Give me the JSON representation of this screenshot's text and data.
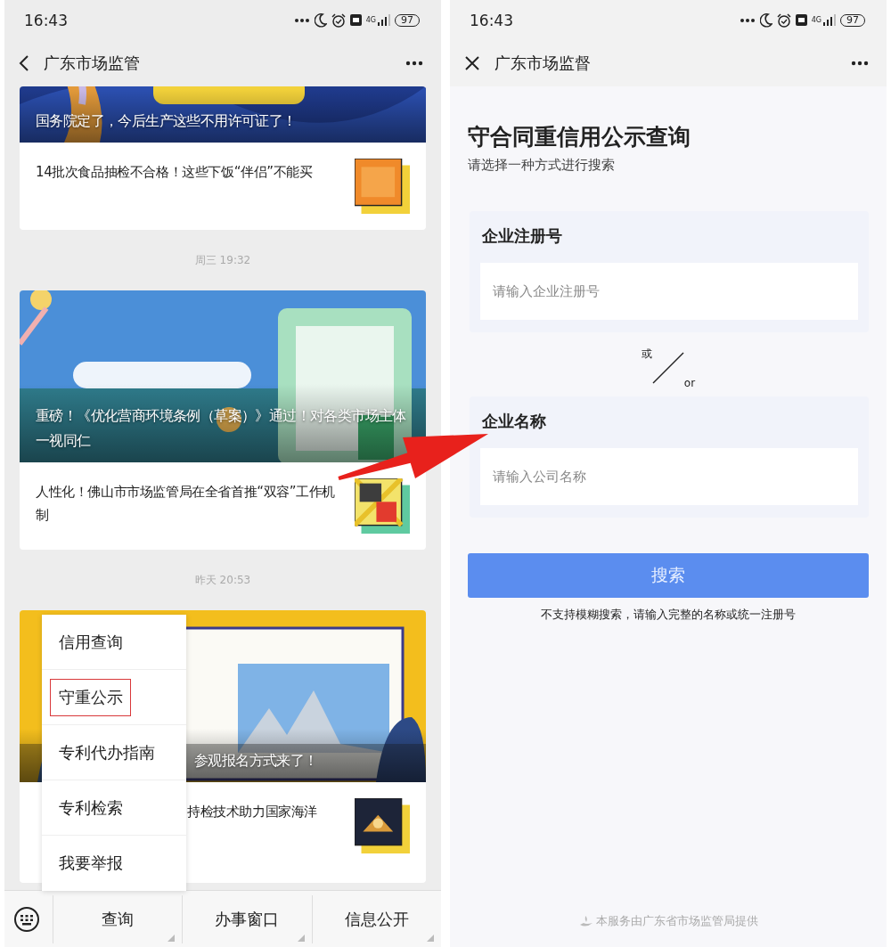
{
  "left_screen": {
    "status_bar": {
      "time": "16:43",
      "network": "4G",
      "battery": "97"
    },
    "nav_bar": {
      "title": "广东市场监管"
    },
    "feed": [
      {
        "kind": "card",
        "headline": "国务院定了，今后生产这些不用许可证了！",
        "article": "14批次食品抽检不合格！这些下饭“伴侣”不能买"
      },
      {
        "kind": "time",
        "text": "周三 19:32"
      },
      {
        "kind": "card",
        "headline": "重磅！《优化营商环境条例（草案）》通过！对各类市场主体一视同仁",
        "article": "人性化！佛山市市场监管局在全省首推“双容”工作机制"
      },
      {
        "kind": "time",
        "text": "昨天 20:53"
      },
      {
        "kind": "card",
        "headline": "参观报名方式来了！",
        "article": "持检技术助力国家海洋"
      }
    ],
    "popup_menu": [
      {
        "label": "信用查询",
        "highlighted": false
      },
      {
        "label": "守重公示",
        "highlighted": true
      },
      {
        "label": "专利代办指南",
        "highlighted": false
      },
      {
        "label": "专利检索",
        "highlighted": false
      },
      {
        "label": "我要举报",
        "highlighted": false
      }
    ],
    "bottom_menu": [
      "查询",
      "办事窗口",
      "信息公开"
    ]
  },
  "right_screen": {
    "status_bar": {
      "time": "16:43",
      "network": "4G",
      "battery": "97"
    },
    "nav_bar": {
      "title": "广东市场监督"
    },
    "title": "守合同重信用公示查询",
    "subtitle": "请选择一种方式进行搜索",
    "sections": [
      {
        "label": "企业注册号",
        "placeholder": "请输入企业注册号"
      },
      {
        "label": "企业名称",
        "placeholder": "请输入公司名称"
      }
    ],
    "divider": {
      "top": "或",
      "bottom": "or"
    },
    "search_button": "搜索",
    "note": "不支持模糊搜索，请输入完整的名称或统一注册号",
    "footer": "本服务由广东省市场监管局提供"
  }
}
